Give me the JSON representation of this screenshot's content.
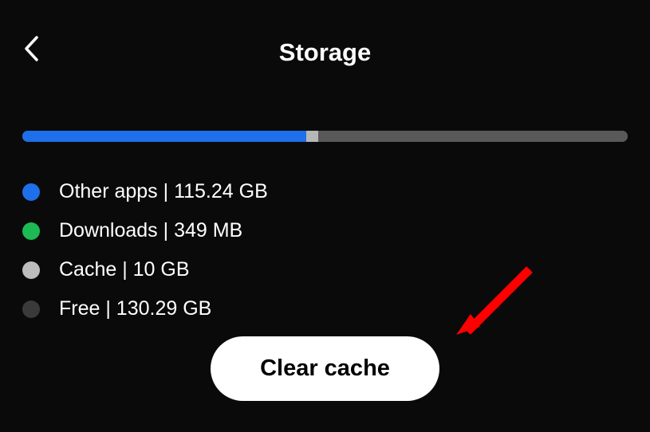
{
  "header": {
    "title": "Storage"
  },
  "storage_bar": {
    "segments": [
      {
        "key": "other",
        "percent": 46.9
      },
      {
        "key": "downloads",
        "percent": 2.0
      },
      {
        "key": "cache",
        "percent": 0.0
      },
      {
        "key": "free",
        "percent": 51.1
      }
    ]
  },
  "legend": [
    {
      "key": "other",
      "label": "Other apps",
      "value": "115.24 GB",
      "text": "Other apps | 115.24 GB"
    },
    {
      "key": "downloads",
      "label": "Downloads",
      "value": "349 MB",
      "text": "Downloads | 349 MB"
    },
    {
      "key": "cache",
      "label": "Cache",
      "value": "10 GB",
      "text": "Cache | 10 GB"
    },
    {
      "key": "free",
      "label": "Free",
      "value": "130.29 GB",
      "text": "Free | 130.29 GB"
    }
  ],
  "buttons": {
    "clear_cache": "Clear cache"
  },
  "colors": {
    "other": "#1e6fea",
    "downloads": "#1db954",
    "cache": "#bdbdbd",
    "free": "#3a3a3a",
    "bar_bg": "#595959",
    "page_bg": "#0a0a0a"
  },
  "chart_data": {
    "type": "bar",
    "title": "Storage",
    "categories": [
      "Other apps",
      "Downloads",
      "Cache",
      "Free"
    ],
    "values_gb": [
      115.24,
      0.349,
      10,
      130.29
    ],
    "display_values": [
      "115.24 GB",
      "349 MB",
      "10 GB",
      "130.29 GB"
    ]
  }
}
